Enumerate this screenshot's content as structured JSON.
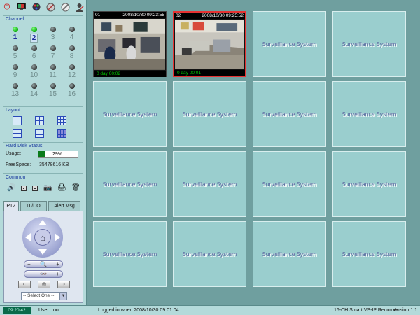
{
  "toolbar": {
    "icons": [
      "power-icon",
      "tv-icon",
      "palette-icon",
      "settings-icon",
      "tools-icon",
      "user-icon"
    ]
  },
  "channel": {
    "title": "Channel",
    "items": [
      {
        "num": "1",
        "active": true
      },
      {
        "num": "2",
        "active": true,
        "selected": true
      },
      {
        "num": "3",
        "active": false
      },
      {
        "num": "4",
        "active": false
      },
      {
        "num": "5",
        "active": false
      },
      {
        "num": "6",
        "active": false
      },
      {
        "num": "7",
        "active": false
      },
      {
        "num": "8",
        "active": false
      },
      {
        "num": "9",
        "active": false
      },
      {
        "num": "10",
        "active": false
      },
      {
        "num": "11",
        "active": false
      },
      {
        "num": "12",
        "active": false
      },
      {
        "num": "13",
        "active": false
      },
      {
        "num": "14",
        "active": false
      },
      {
        "num": "15",
        "active": false
      },
      {
        "num": "16",
        "active": false
      }
    ]
  },
  "layout": {
    "title": "Layout",
    "options": [
      "single",
      "quad",
      "nine",
      "quad",
      "nine",
      "sixteen"
    ],
    "selected_index": 5
  },
  "hdd": {
    "title": "Hard Disk Status",
    "usage_label": "Usage:",
    "usage_value": "29%",
    "usage_fraction": 0.29,
    "free_label": "FreeSpace:",
    "free_value": "35478616 KB"
  },
  "common": {
    "title": "Common"
  },
  "tabs": [
    {
      "label": "PTZ",
      "active": true
    },
    {
      "label": "DI/DO",
      "active": false
    },
    {
      "label": "Alert Msg",
      "active": false
    }
  ],
  "ptz": {
    "select_value": "-- Select One --"
  },
  "cameras": [
    {
      "ch": "01",
      "timestamp": "2008/10/30 09:23:55",
      "footer": "0 day  00:02",
      "selected": false
    },
    {
      "ch": "02",
      "timestamp": "2008/10/30 09:25:52",
      "footer": "0 day  00:01",
      "selected": true
    }
  ],
  "placeholder_text": "Surveillance System",
  "statusbar": {
    "clock": "09:20:42",
    "user": "User: root",
    "login": "Logged in when  2008/10/30 09:01:04",
    "product": "16-CH Smart VS-IP Recorder",
    "version": "Version 1.1"
  },
  "colors": {
    "background": "#6f9f9f",
    "panel": "#b4dada",
    "cell": "#9acece",
    "selected_border": "#e63232",
    "usage_fill": "#0a7a1a"
  }
}
